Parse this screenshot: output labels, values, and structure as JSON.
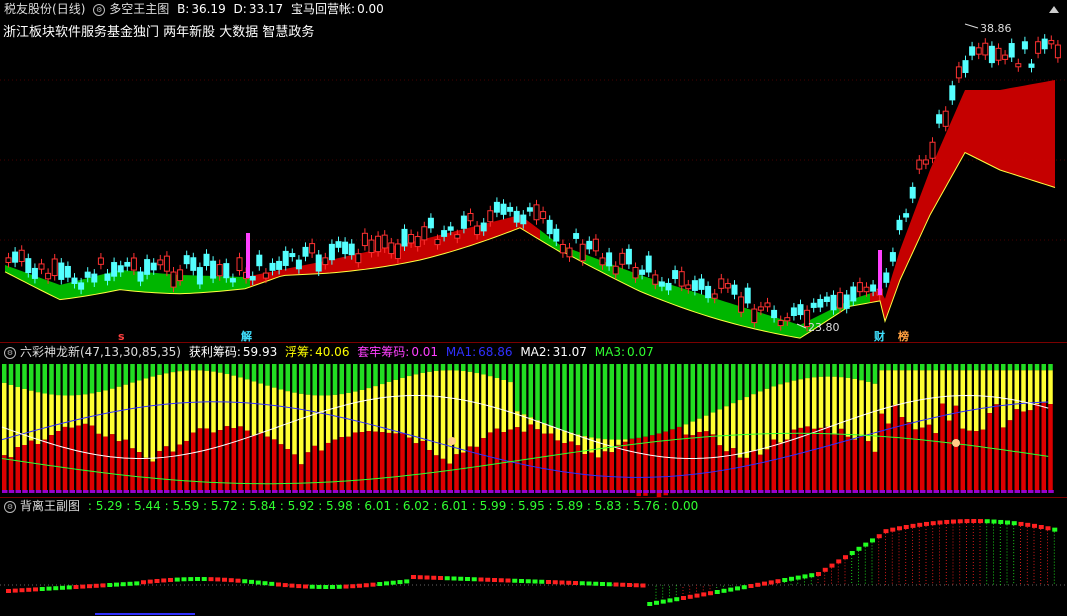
{
  "main": {
    "stock": "税友股份",
    "period": "(日线)",
    "indicator": "多空王主图",
    "b_label": "B:",
    "b_value": "36.19",
    "d_label": "D:",
    "d_value": "33.17",
    "bm_label": "宝马回营帐:",
    "bm_value": "0.00",
    "concepts": "浙江板块软件服务基金独门 两年新股 大数据 智慧政务",
    "high_price": "38.86",
    "low_price": "23.80",
    "tag_s": "s",
    "tag_jie": "解",
    "tag_cai": "财",
    "tag_bang": "榜",
    "colors": {
      "up": "#ff3232",
      "down": "#54ffff",
      "band_up": "#dd0000",
      "band_down": "#00dd00"
    }
  },
  "sub1": {
    "name": "六彩神龙新(47,13,30,85,35)",
    "profit_label": "获利筹码:",
    "profit_value": "59.93",
    "float_label": "浮筹:",
    "float_value": "40.06",
    "trap_label": "套牢筹码:",
    "trap_value": "0.01",
    "ma1_label": "MA1:",
    "ma1_value": "68.86",
    "ma2_label": "MA2:",
    "ma2_value": "31.07",
    "ma3_label": "MA3:",
    "ma3_value": "0.07"
  },
  "sub2": {
    "name": "背离王副图",
    "values": ": 5.29 : 5.44 : 5.59 : 5.72 : 5.84 : 5.92 : 5.98 : 6.01 : 6.02 : 6.01 : 5.99 : 5.95 : 5.89 : 5.83 : 5.76 : 0.00"
  }
}
